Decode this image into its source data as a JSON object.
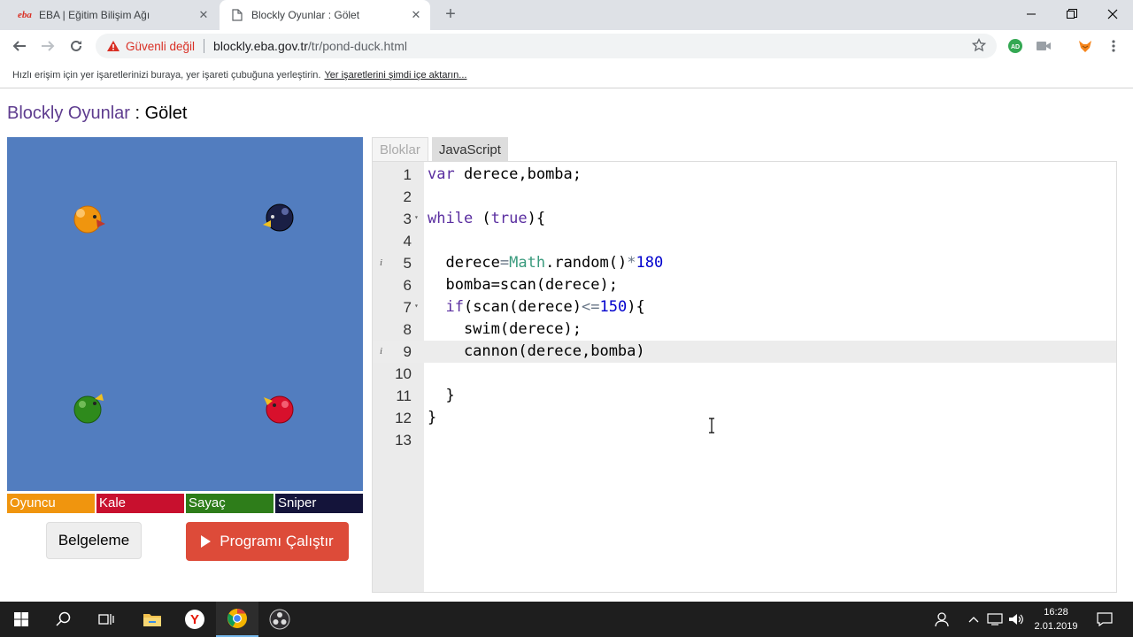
{
  "browser": {
    "tabs": [
      {
        "title": "EBA | Eğitim Bilişim Ağı",
        "favicon": "eba",
        "active": false
      },
      {
        "title": "Blockly Oyunlar : Gölet",
        "favicon": "page-icon",
        "active": true
      }
    ],
    "address": {
      "security_label": "Güvenli değil",
      "host": "blockly.eba.gov.tr",
      "path": "/tr/pond-duck.html"
    },
    "bookmarks_bar": {
      "message": "Hızlı erişim için yer işaretlerinizi buraya, yer işareti çubuğuna yerleştirin.",
      "import_link": "Yer işaretlerini şimdi içe aktarın..."
    }
  },
  "page": {
    "title_app": "Blockly Oyunlar",
    "title_sep": " : ",
    "title_game": "Gölet",
    "players": [
      {
        "name": "Oyuncu",
        "color": "#f0950e"
      },
      {
        "name": "Kale",
        "color": "#c8102e"
      },
      {
        "name": "Sayaç",
        "color": "#2e7d1a"
      },
      {
        "name": "Sniper",
        "color": "#14143a"
      }
    ],
    "docs_button": "Belgeleme",
    "run_button": "Programı Çalıştır",
    "editor_tabs": {
      "blocks": "Bloklar",
      "javascript": "JavaScript"
    },
    "code_lines": [
      {
        "n": "1"
      },
      {
        "n": "2"
      },
      {
        "n": "3"
      },
      {
        "n": "4"
      },
      {
        "n": "5"
      },
      {
        "n": "6"
      },
      {
        "n": "7"
      },
      {
        "n": "8"
      },
      {
        "n": "9"
      },
      {
        "n": "10"
      },
      {
        "n": "11"
      },
      {
        "n": "12"
      },
      {
        "n": "13"
      }
    ],
    "code": {
      "l1_kw": "var",
      "l1_rest": " derece,bomba;",
      "l3_kw": "while",
      "l3_a": " (",
      "l3_true": "true",
      "l3_b": "){",
      "l5_a": "  derece",
      "l5_eq": "=",
      "l5_math": "Math",
      "l5_b": ".random()",
      "l5_mul": "*",
      "l5_num": "180",
      "l6": "  bomba=scan(derece);",
      "l7_kw": "  if",
      "l7_a": "(scan(derece)",
      "l7_op": "<=",
      "l7_num": "150",
      "l7_b": "){",
      "l8": "    swim(derece);",
      "l9": "    cannon(derece,bomba)",
      "l11": "  }",
      "l12": "}"
    },
    "info_marker": "i"
  },
  "taskbar": {
    "time": "16:28",
    "date": "2.01.2019"
  }
}
